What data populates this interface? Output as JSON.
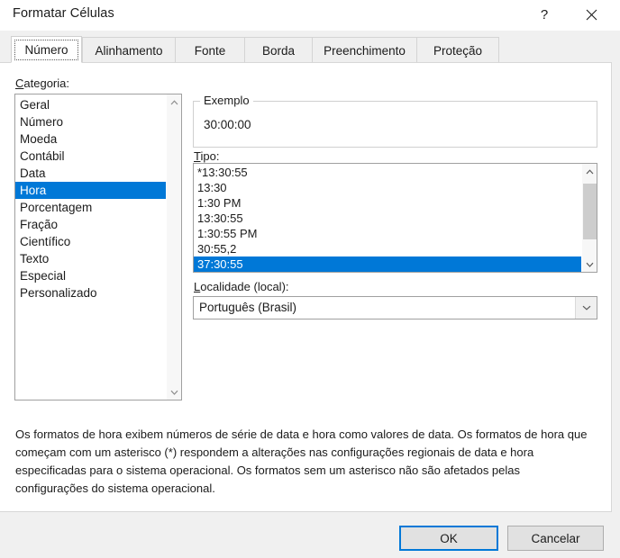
{
  "window": {
    "title": "Formatar Células",
    "help_label": "?",
    "close_label": "✕"
  },
  "tabs": [
    {
      "label": "Número",
      "active": true
    },
    {
      "label": "Alinhamento",
      "active": false
    },
    {
      "label": "Fonte",
      "active": false
    },
    {
      "label": "Borda",
      "active": false
    },
    {
      "label": "Preenchimento",
      "active": false
    },
    {
      "label": "Proteção",
      "active": false
    }
  ],
  "category": {
    "label_accel": "C",
    "label_rest": "ategoria:",
    "items": [
      "Geral",
      "Número",
      "Moeda",
      "Contábil",
      "Data",
      "Hora",
      "Porcentagem",
      "Fração",
      "Científico",
      "Texto",
      "Especial",
      "Personalizado"
    ],
    "selected": "Hora",
    "scroll_up_glyph": "⌃",
    "scroll_down_glyph": "⌄"
  },
  "example": {
    "legend": "Exemplo",
    "value": "30:00:00"
  },
  "type": {
    "label_accel": "T",
    "label_rest": "ipo:",
    "items": [
      "*13:30:55",
      "13:30",
      "1:30 PM",
      "13:30:55",
      "1:30:55 PM",
      "30:55,2",
      "37:30:55"
    ],
    "selected": "37:30:55",
    "scroll_up_glyph": "⌃",
    "scroll_down_glyph": "⌄"
  },
  "locale": {
    "label_accel": "L",
    "label_rest": "ocalidade (local):",
    "value": "Português (Brasil)",
    "dropdown_glyph": "⌄"
  },
  "description": "Os formatos de hora exibem números de série de data e hora como valores de data. Os formatos de hora que começam com um asterisco (*) respondem a alterações nas configurações regionais de data e hora especificadas para o sistema operacional. Os formatos sem um asterisco não são afetados pelas configurações do sistema operacional.",
  "footer": {
    "ok_label": "OK",
    "cancel_label": "Cancelar"
  },
  "colors": {
    "selection_blue": "#0078d7",
    "dialog_bg": "#f0f0f0",
    "panel_bg": "#ffffff"
  }
}
